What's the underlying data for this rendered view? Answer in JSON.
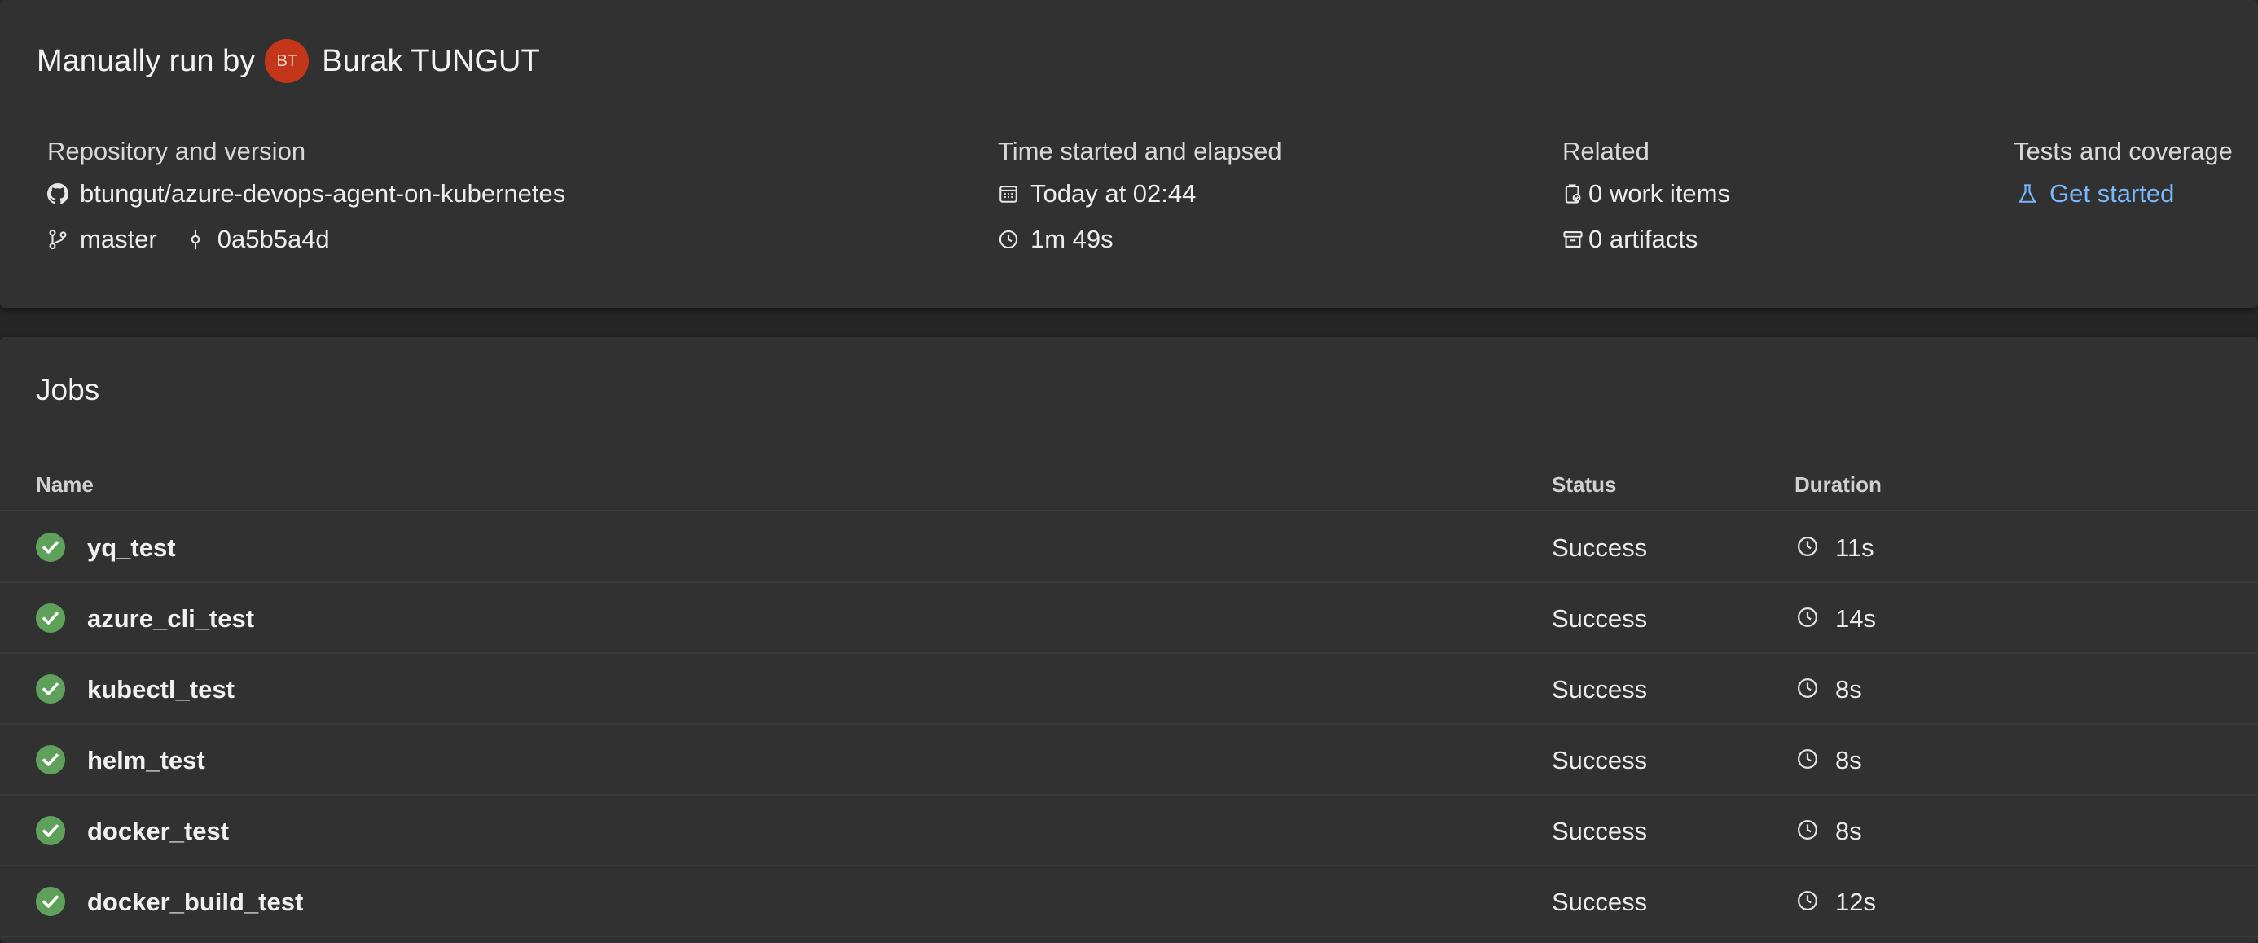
{
  "summary": {
    "run_prefix": "Manually run by",
    "avatar_initials": "BT",
    "user_name": "Burak TUNGUT",
    "repository": {
      "heading": "Repository and version",
      "repo_name": "btungut/azure-devops-agent-on-kubernetes",
      "branch": "master",
      "commit": "0a5b5a4d"
    },
    "time": {
      "heading": "Time started and elapsed",
      "started": "Today at 02:44",
      "elapsed": "1m 49s"
    },
    "related": {
      "heading": "Related",
      "work_items": "0 work items",
      "artifacts": "0 artifacts"
    },
    "tests": {
      "heading": "Tests and coverage",
      "link_label": "Get started"
    }
  },
  "jobs": {
    "title": "Jobs",
    "columns": {
      "name": "Name",
      "status": "Status",
      "duration": "Duration"
    },
    "rows": [
      {
        "name": "yq_test",
        "status": "Success",
        "duration": "11s"
      },
      {
        "name": "azure_cli_test",
        "status": "Success",
        "duration": "14s"
      },
      {
        "name": "kubectl_test",
        "status": "Success",
        "duration": "8s"
      },
      {
        "name": "helm_test",
        "status": "Success",
        "duration": "8s"
      },
      {
        "name": "docker_test",
        "status": "Success",
        "duration": "8s"
      },
      {
        "name": "docker_build_test",
        "status": "Success",
        "duration": "12s"
      }
    ]
  },
  "colors": {
    "success_green": "#5fa15a",
    "link_blue": "#79b8ff",
    "avatar_bg": "#c4361a"
  },
  "icons": {
    "repo": "github-icon",
    "branch": "branch-icon",
    "commit": "commit-icon",
    "calendar": "calendar-icon",
    "clock": "clock-icon",
    "work_items": "work-items-icon",
    "artifacts": "artifacts-icon",
    "tests": "beaker-icon",
    "status": "success-check-icon"
  }
}
